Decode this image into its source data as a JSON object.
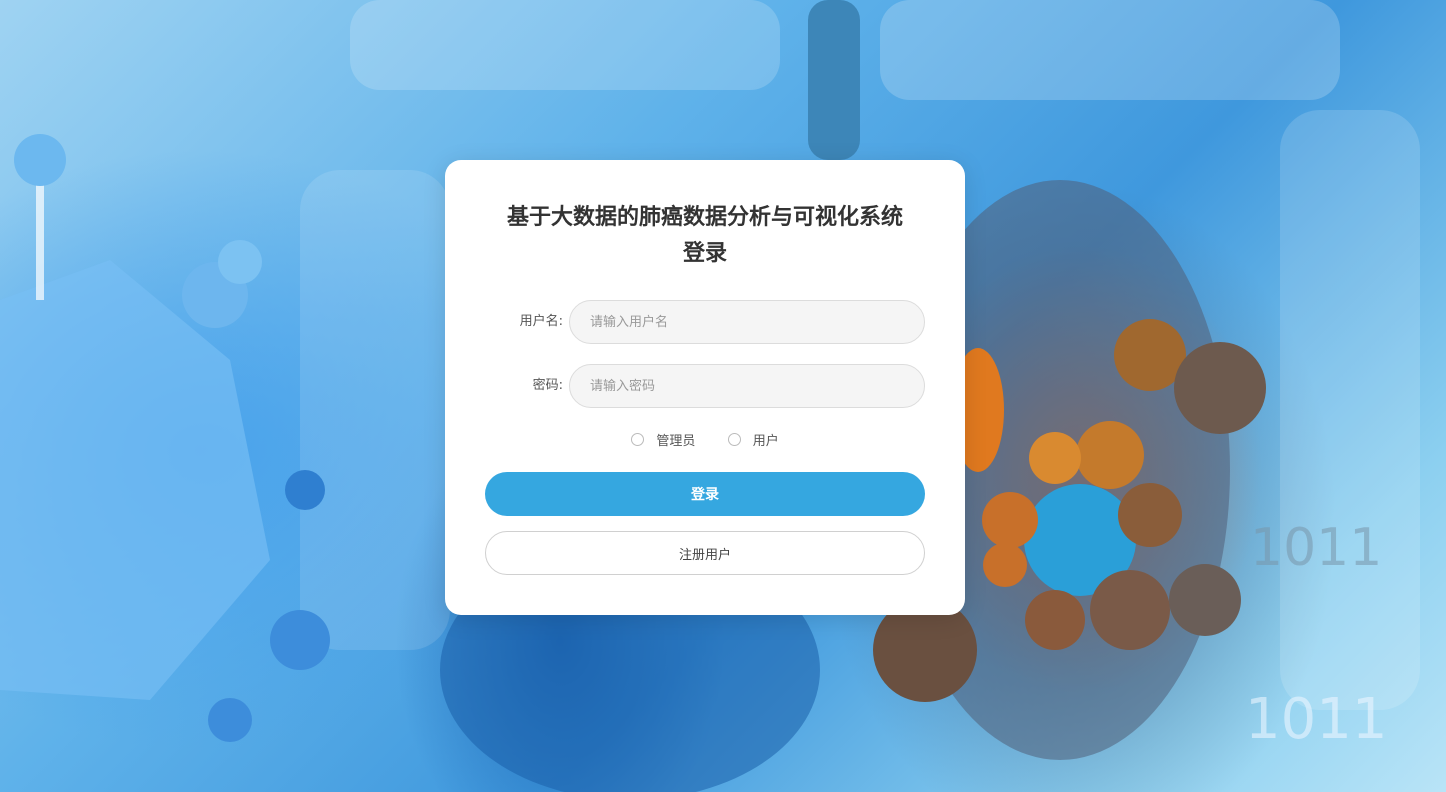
{
  "login": {
    "title_line1": "基于大数据的肺癌数据分析与可视化系统",
    "title_line2": "登录",
    "username_label": "用户名:",
    "username_placeholder": "请输入用户名",
    "password_label": "密码:",
    "password_placeholder": "请输入密码",
    "roles": [
      {
        "label": "管理员",
        "selected": false
      },
      {
        "label": "用户",
        "selected": false
      }
    ],
    "login_button": "登录",
    "register_button": "注册用户"
  },
  "background": {
    "numbers_upper": "1011",
    "numbers_lower": "1011"
  },
  "colors": {
    "accent": "#35a7e0",
    "card": "#ffffff"
  }
}
